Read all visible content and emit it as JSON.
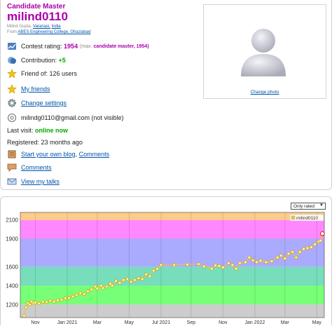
{
  "profile": {
    "rank": "Candidate Master",
    "handle": "milind0110",
    "name": "Milind Gupta,",
    "city": "Varanasi,",
    "country": "India",
    "from_label": "From",
    "organization": "ABES Engineering College, Ghaziabad"
  },
  "info": {
    "rating_label": "Contest rating:",
    "rating_value": "1954",
    "max_prefix": "(max.",
    "max_rank": "candidate master,",
    "max_value": "1954)",
    "contribution_label": "Contribution:",
    "contribution_value": "+5",
    "friend_of": "Friend of: 126 users",
    "my_friends": "My friends",
    "change_settings": "Change settings",
    "email": "milindg0110@gmail.com (not visible)",
    "last_visit_label": "Last visit:",
    "last_visit_value": "online now",
    "registered": "Registered: 23 months ago",
    "blog_link": "Start your own blog",
    "blog_sep": ",",
    "comments_inline": "Comments",
    "comments": "Comments",
    "talks": "View my talks"
  },
  "photo": {
    "change_label": "Change photo"
  },
  "filter": {
    "selected": "Only rated"
  },
  "colors": {
    "rank_violet": "#aa00aa",
    "link_blue": "#0055aa",
    "online_green": "#00aa00",
    "series_line": "#edc240"
  },
  "icons": [
    "rating-icon",
    "contribution-icon",
    "star-icon",
    "star-icon",
    "settings-icon",
    "email-icon",
    "blog-icon",
    "comments-icon",
    "talks-icon"
  ],
  "chart_data": {
    "type": "line",
    "legend": "milind0110",
    "legend_position": "top-right",
    "ylim": [
      1060,
      2180
    ],
    "y_ticks": [
      1200,
      1400,
      1600,
      1900,
      2100
    ],
    "bands": [
      {
        "from": 1060,
        "to": 1200,
        "color": "#cccccc"
      },
      {
        "from": 1200,
        "to": 1400,
        "color": "#77ff77"
      },
      {
        "from": 1400,
        "to": 1600,
        "color": "#77ddbb"
      },
      {
        "from": 1600,
        "to": 1900,
        "color": "#aaaaff"
      },
      {
        "from": 1900,
        "to": 2100,
        "color": "#ff88ff"
      },
      {
        "from": 2100,
        "to": 2180,
        "color": "#ffcc88"
      }
    ],
    "x_ticks": [
      {
        "month": "Nov",
        "year": "2020",
        "t": 2020.83
      },
      {
        "month": "Jan 2021",
        "year": "",
        "t": 2021.0
      },
      {
        "month": "Mar",
        "year": "2021",
        "t": 2021.16
      },
      {
        "month": "May",
        "year": "2021",
        "t": 2021.33
      },
      {
        "month": "Jul 2021",
        "year": "",
        "t": 2021.5
      },
      {
        "month": "Sep",
        "year": "2021",
        "t": 2021.66
      },
      {
        "month": "Nov",
        "year": "2021",
        "t": 2021.83
      },
      {
        "month": "Jan 2022",
        "year": "",
        "t": 2022.0
      },
      {
        "month": "Mar",
        "year": "2022",
        "t": 2022.16
      },
      {
        "month": "May",
        "year": "2022",
        "t": 2022.33
      }
    ],
    "xlim": [
      2020.75,
      2022.37
    ],
    "points": [
      [
        2020.77,
        1080
      ],
      [
        2020.78,
        1170
      ],
      [
        2020.79,
        1215
      ],
      [
        2020.8,
        1200
      ],
      [
        2020.81,
        1230
      ],
      [
        2020.82,
        1215
      ],
      [
        2020.83,
        1220
      ],
      [
        2020.85,
        1210
      ],
      [
        2020.87,
        1230
      ],
      [
        2020.89,
        1225
      ],
      [
        2020.91,
        1240
      ],
      [
        2020.93,
        1230
      ],
      [
        2020.95,
        1245
      ],
      [
        2020.97,
        1250
      ],
      [
        2020.99,
        1265
      ],
      [
        2021.01,
        1270
      ],
      [
        2021.03,
        1285
      ],
      [
        2021.05,
        1300
      ],
      [
        2021.07,
        1320
      ],
      [
        2021.09,
        1310
      ],
      [
        2021.11,
        1340
      ],
      [
        2021.13,
        1360
      ],
      [
        2021.15,
        1390
      ],
      [
        2021.16,
        1370
      ],
      [
        2021.18,
        1400
      ],
      [
        2021.19,
        1375
      ],
      [
        2021.21,
        1390
      ],
      [
        2021.23,
        1420
      ],
      [
        2021.24,
        1400
      ],
      [
        2021.26,
        1450
      ],
      [
        2021.28,
        1430
      ],
      [
        2021.3,
        1460
      ],
      [
        2021.32,
        1470
      ],
      [
        2021.34,
        1440
      ],
      [
        2021.36,
        1460
      ],
      [
        2021.38,
        1480
      ],
      [
        2021.4,
        1470
      ],
      [
        2021.42,
        1520
      ],
      [
        2021.44,
        1500
      ],
      [
        2021.46,
        1560
      ],
      [
        2021.48,
        1580
      ],
      [
        2021.5,
        1620
      ],
      [
        2021.57,
        1620
      ],
      [
        2021.64,
        1625
      ],
      [
        2021.7,
        1630
      ],
      [
        2021.73,
        1605
      ],
      [
        2021.77,
        1580
      ],
      [
        2021.79,
        1615
      ],
      [
        2021.81,
        1610
      ],
      [
        2021.83,
        1595
      ],
      [
        2021.86,
        1640
      ],
      [
        2021.88,
        1620
      ],
      [
        2021.9,
        1580
      ],
      [
        2021.92,
        1640
      ],
      [
        2021.95,
        1650
      ],
      [
        2021.97,
        1700
      ],
      [
        2021.99,
        1670
      ],
      [
        2022.01,
        1650
      ],
      [
        2022.03,
        1665
      ],
      [
        2022.06,
        1650
      ],
      [
        2022.09,
        1660
      ],
      [
        2022.12,
        1700
      ],
      [
        2022.14,
        1720
      ],
      [
        2022.16,
        1690
      ],
      [
        2022.18,
        1740
      ],
      [
        2022.2,
        1760
      ],
      [
        2022.22,
        1700
      ],
      [
        2022.24,
        1760
      ],
      [
        2022.26,
        1790
      ],
      [
        2022.28,
        1800
      ],
      [
        2022.3,
        1810
      ],
      [
        2022.32,
        1840
      ],
      [
        2022.34,
        1870
      ],
      [
        2022.35,
        1880
      ],
      [
        2022.36,
        1954
      ]
    ]
  }
}
